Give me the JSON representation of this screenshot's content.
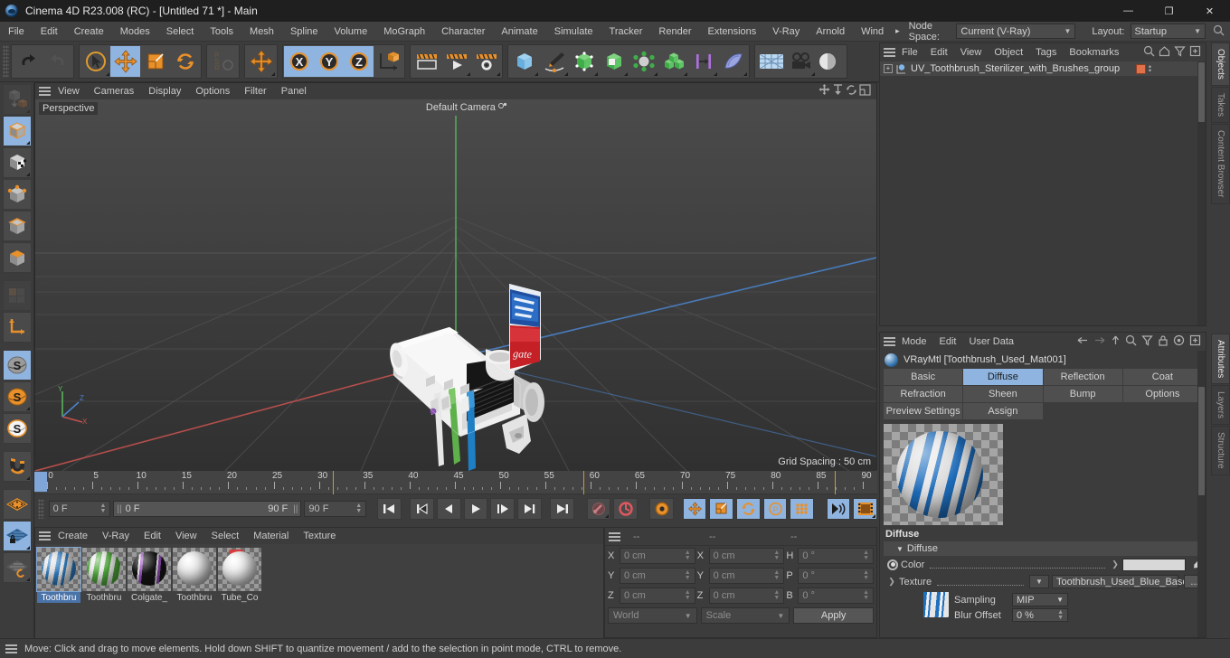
{
  "window": {
    "title": "Cinema 4D R23.008 (RC) - [Untitled 71 *] - Main",
    "minimize": "—",
    "maximize": "❐",
    "close": "✕"
  },
  "menubar": {
    "items": [
      "File",
      "Edit",
      "Create",
      "Modes",
      "Select",
      "Tools",
      "Mesh",
      "Spline",
      "Volume",
      "MoGraph",
      "Character",
      "Animate",
      "Simulate",
      "Tracker",
      "Render",
      "Extensions",
      "V-Ray",
      "Arnold",
      "Wind"
    ],
    "overflow_arrow": "▸",
    "node_space_label": "Node Space:",
    "node_space_value": "Current (V-Ray)",
    "layout_label": "Layout:",
    "layout_value": "Startup"
  },
  "viewport": {
    "menu": [
      "View",
      "Cameras",
      "Display",
      "Options",
      "Filter",
      "Panel"
    ],
    "label": "Perspective",
    "camera": "Default Camera",
    "grid_spacing": "Grid Spacing : 50 cm",
    "axis_x": "X",
    "axis_y": "Y",
    "axis_z": "Z"
  },
  "timeline": {
    "ticks": [
      0,
      5,
      10,
      15,
      20,
      25,
      30,
      35,
      40,
      45,
      50,
      55,
      60,
      65,
      70,
      75,
      80,
      85,
      90
    ],
    "current_frame": "0 F",
    "range_start": "0 F",
    "range_end": "90 F",
    "end_frame": "90 F",
    "preview_frame": "0 F"
  },
  "materials": {
    "menu": [
      "Create",
      "V-Ray",
      "Edit",
      "View",
      "Select",
      "Material",
      "Texture"
    ],
    "items": [
      {
        "name": "Toothbru",
        "selected": true,
        "color": "#2f7cc2"
      },
      {
        "name": "Toothbru",
        "selected": false,
        "color": "#4fa83a"
      },
      {
        "name": "Colgate_",
        "selected": false,
        "color": "#151515"
      },
      {
        "name": "Toothbru",
        "selected": false,
        "color": "#dcdcdc"
      },
      {
        "name": "Tube_Co",
        "selected": false,
        "color": "#e0e0e0"
      }
    ]
  },
  "coordinates": {
    "header": [
      "--",
      "--",
      "--"
    ],
    "rows": [
      {
        "l1": "X",
        "v1": "0 cm",
        "l2": "X",
        "v2": "0 cm",
        "l3": "H",
        "v3": "0 °"
      },
      {
        "l1": "Y",
        "v1": "0 cm",
        "l2": "Y",
        "v2": "0 cm",
        "l3": "P",
        "v3": "0 °"
      },
      {
        "l1": "Z",
        "v1": "0 cm",
        "l2": "Z",
        "v2": "0 cm",
        "l3": "B",
        "v3": "0 °"
      }
    ],
    "system": "World",
    "mode": "Scale",
    "apply": "Apply"
  },
  "objects": {
    "menu": [
      "File",
      "Edit",
      "View",
      "Object",
      "Tags",
      "Bookmarks"
    ],
    "root_item": "UV_Toothbrush_Sterilizer_with_Brushes_group",
    "tag_color": "#e0714a"
  },
  "attributes": {
    "menu": [
      "Mode",
      "Edit",
      "User Data"
    ],
    "material_title": "VRayMtl [Toothbrush_Used_Mat001]",
    "tabs": [
      "Basic",
      "Diffuse",
      "Reflection",
      "Coat",
      "Refraction",
      "Sheen",
      "Bump",
      "Options",
      "Preview Settings",
      "Assign"
    ],
    "active_tab": "Diffuse",
    "section_title": "Diffuse",
    "group_title": "Diffuse",
    "color_label": "Color",
    "texture_label": "Texture",
    "texture_value": "Toothbrush_Used_Blue_Base",
    "texture_more": "...",
    "sampling_label": "Sampling",
    "sampling_value": "MIP",
    "blur_label": "Blur Offset",
    "blur_value": "0 %",
    "color_swatch": "#d8d8d8"
  },
  "side_tabs_top": [
    {
      "label": "Objects",
      "active": true
    },
    {
      "label": "Takes",
      "active": false
    },
    {
      "label": "Content Browser",
      "active": false
    }
  ],
  "side_tabs_bottom": [
    {
      "label": "Attributes",
      "active": true
    },
    {
      "label": "Layers",
      "active": false
    },
    {
      "label": "Structure",
      "active": false
    }
  ],
  "statusbar": {
    "message": "Move: Click and drag to move elements. Hold down SHIFT to quantize movement / add to the selection in point mode, CTRL to remove."
  }
}
